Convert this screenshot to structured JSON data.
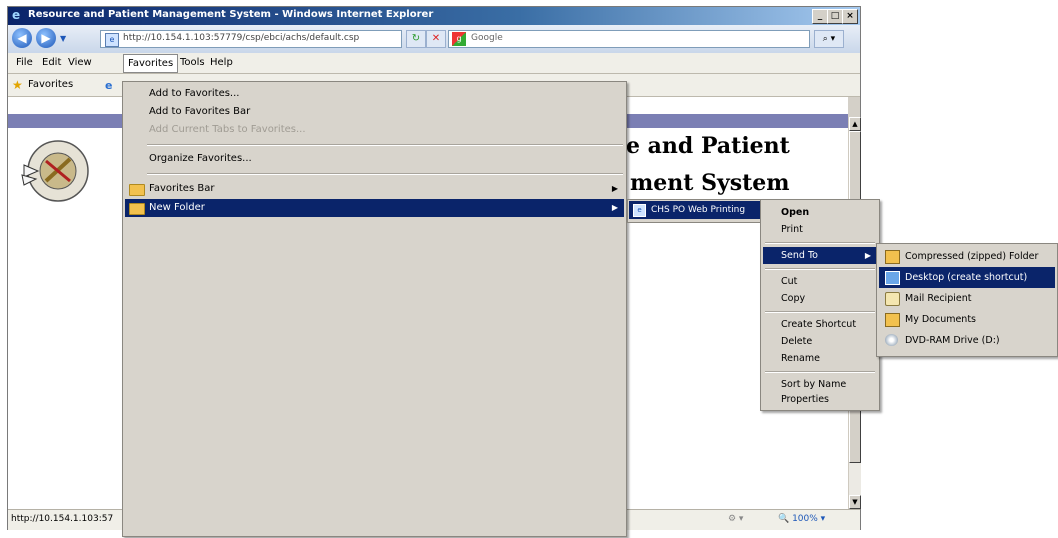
{
  "window": {
    "title": "Resource and Patient Management System - Windows Internet Explorer",
    "controls": [
      "_",
      "□",
      "×"
    ]
  },
  "nav": {
    "address": "http://10.154.1.103:57779/csp/ebci/achs/default.csp",
    "search_placeholder": "Google"
  },
  "menubar": [
    "File",
    "Edit",
    "View",
    "Favorites",
    "Tools",
    "Help"
  ],
  "favorites_bar": {
    "label": "Favorites"
  },
  "page": {
    "heading_line1": "e and Patient",
    "heading_line2": "ment System",
    "logo_text": "INDIAN HEALTH SERVICE · PHS · 1955"
  },
  "favorites_menu": {
    "items": [
      {
        "label": "Add to Favorites...",
        "enabled": true
      },
      {
        "label": "Add to Favorites Bar",
        "enabled": true
      },
      {
        "label": "Add Current Tabs to Favorites...",
        "enabled": false
      },
      {
        "label": "Organize Favorites...",
        "enabled": true
      },
      {
        "label": "Favorites Bar",
        "enabled": true,
        "submenu": true
      },
      {
        "label": "New Folder",
        "enabled": true,
        "submenu": true,
        "selected": true
      }
    ]
  },
  "folder_item": {
    "label": "CHS PO Web Printing"
  },
  "context_menu": {
    "items": [
      {
        "label": "Open",
        "bold": true
      },
      {
        "label": "Print"
      },
      {
        "label": "Send To",
        "selected": true,
        "submenu": true
      },
      {
        "label": "Cut"
      },
      {
        "label": "Copy"
      },
      {
        "label": "Create Shortcut"
      },
      {
        "label": "Delete"
      },
      {
        "label": "Rename"
      },
      {
        "label": "Sort by Name"
      },
      {
        "label": "Properties"
      }
    ]
  },
  "send_to_menu": {
    "items": [
      {
        "label": "Compressed (zipped) Folder",
        "icon": "zip-folder-icon"
      },
      {
        "label": "Desktop (create shortcut)",
        "icon": "desktop-icon",
        "selected": true
      },
      {
        "label": "Mail Recipient",
        "icon": "mail-icon"
      },
      {
        "label": "My Documents",
        "icon": "documents-folder-icon"
      },
      {
        "label": "DVD-RAM Drive (D:)",
        "icon": "dvd-drive-icon"
      }
    ]
  },
  "status": {
    "url": "http://10.154.1.103:57",
    "zoom": "100%"
  }
}
